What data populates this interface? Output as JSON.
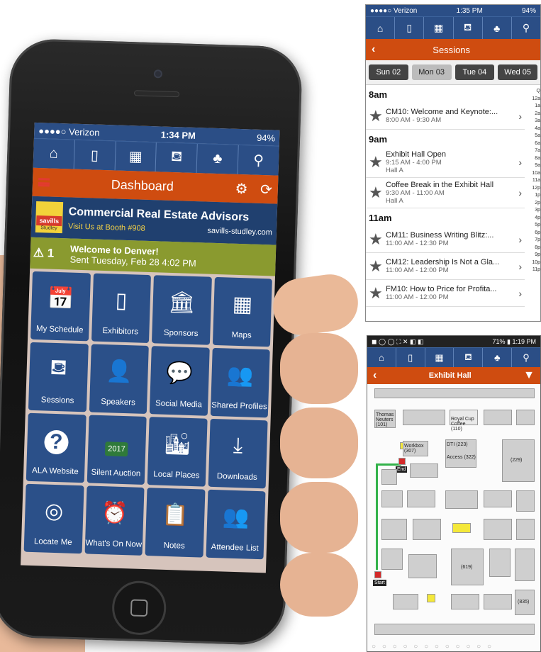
{
  "phone": {
    "status": {
      "carrier": "●●●●○ Verizon",
      "time": "1:34 PM",
      "battery": "94%"
    },
    "nav_icons": [
      "home-icon",
      "phone-icon",
      "qr-icon",
      "presentation-icon",
      "speaker-icon",
      "search-icon"
    ],
    "title": "Dashboard",
    "banner": {
      "logo_top": "savills",
      "logo_bottom": "Studley",
      "headline": "Commercial Real Estate Advisors",
      "booth": "Visit Us at Booth #908",
      "url": "savills-studley.com"
    },
    "alert": {
      "count": "⚠ 1",
      "title": "Welcome to Denver!",
      "sent": "Sent Tuesday, Feb 28 4:02 PM"
    },
    "tiles": [
      {
        "label": "My Schedule",
        "icon": "📅"
      },
      {
        "label": "Exhibitors",
        "icon": "▯"
      },
      {
        "label": "Sponsors",
        "icon": "🏛"
      },
      {
        "label": "Maps",
        "icon": "▦"
      },
      {
        "label": "Sessions",
        "icon": "⛾"
      },
      {
        "label": "Speakers",
        "icon": "👤"
      },
      {
        "label": "Social Media",
        "icon": "💬"
      },
      {
        "label": "Shared Profiles",
        "icon": "👥"
      },
      {
        "label": "ALA Website",
        "icon": "?"
      },
      {
        "label": "Silent Auction",
        "icon": "2017"
      },
      {
        "label": "Local Places",
        "icon": "🏙"
      },
      {
        "label": "Downloads",
        "icon": "⤓"
      },
      {
        "label": "Locate Me",
        "icon": "◎"
      },
      {
        "label": "What's On Now",
        "icon": "⏰"
      },
      {
        "label": "Notes",
        "icon": "📋"
      },
      {
        "label": "Attendee List",
        "icon": "👥"
      }
    ]
  },
  "sessions": {
    "status": {
      "carrier": "●●●●○ Verizon",
      "time": "1:35 PM",
      "battery": "94%"
    },
    "title": "Sessions",
    "days": [
      "Sun 02",
      "Mon 03",
      "Tue 04",
      "Wed 05"
    ],
    "active_day": "Mon 03",
    "groups": [
      {
        "hour": "8am",
        "items": [
          {
            "title": "CM10: Welcome and Keynote:...",
            "time": "8:00 AM - 9:30 AM",
            "place": ""
          }
        ]
      },
      {
        "hour": "9am",
        "items": [
          {
            "title": "Exhibit Hall Open",
            "time": "9:15 AM - 4:00 PM",
            "place": "Hall A"
          },
          {
            "title": "Coffee Break in the Exhibit Hall",
            "time": "9:30 AM - 11:00 AM",
            "place": "Hall A"
          }
        ]
      },
      {
        "hour": "11am",
        "items": [
          {
            "title": "CM11: Business Writing Blitz:...",
            "time": "11:00 AM - 12:30 PM",
            "place": ""
          },
          {
            "title": "CM12: Leadership Is Not a Gla...",
            "time": "11:00 AM - 12:00 PM",
            "place": ""
          },
          {
            "title": "FM10: How to Price for Profita...",
            "time": "11:00 AM - 12:00 PM",
            "place": ""
          }
        ]
      }
    ],
    "timeline": [
      "Q",
      "12a",
      "1a",
      "2a",
      "3a",
      "4a",
      "5a",
      "6a",
      "7a",
      "8a",
      "9a",
      "10a",
      "11a",
      "12p",
      "1p",
      "2p",
      "3p",
      "4p",
      "5p",
      "6p",
      "7p",
      "8p",
      "9p",
      "10p",
      "11p"
    ]
  },
  "map": {
    "status": {
      "left": "◼ ◯ ◯ ⛶ ✕ ◧ ◧",
      "right": "71% ▮ 1:19 PM"
    },
    "title": "Exhibit Hall",
    "labels": {
      "thomas": "Thomas Neuters (101)",
      "royal": "Royal Cup Coffee (110)",
      "workbox": "Workbox (307)",
      "dti": "DTI (223)",
      "access": "Access (322)",
      "end": "End",
      "start": "Start",
      "b229": "(229)",
      "b619": "(619)",
      "b835": "(835)"
    }
  }
}
